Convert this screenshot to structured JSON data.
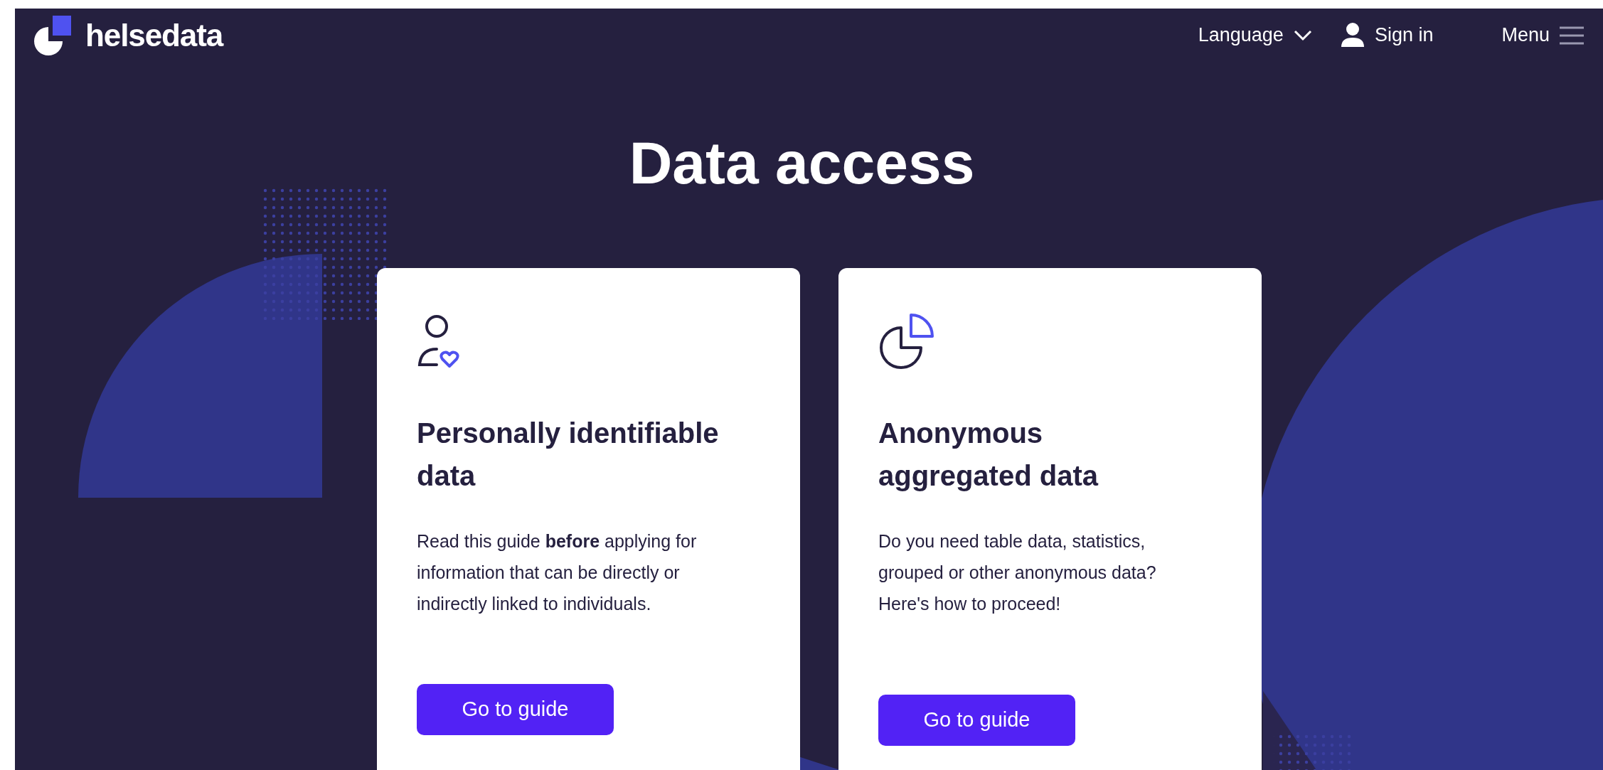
{
  "header": {
    "logo": "helsedata",
    "language": "Language",
    "sign_in": "Sign in",
    "menu": "Menu"
  },
  "title": "Data access",
  "cards": [
    {
      "kind": "person",
      "heading": "Personally identifiable data",
      "text": "Read this guide **before** applying for information that can be directly or indirectly linked to individuals.",
      "button": "Go to guide"
    },
    {
      "kind": "chart",
      "heading": "Anonymous aggregated data",
      "text": "Do you need table data, statistics, grouped or other anonymous data? Here's how to proceed!",
      "button": "Go to guide"
    }
  ]
}
